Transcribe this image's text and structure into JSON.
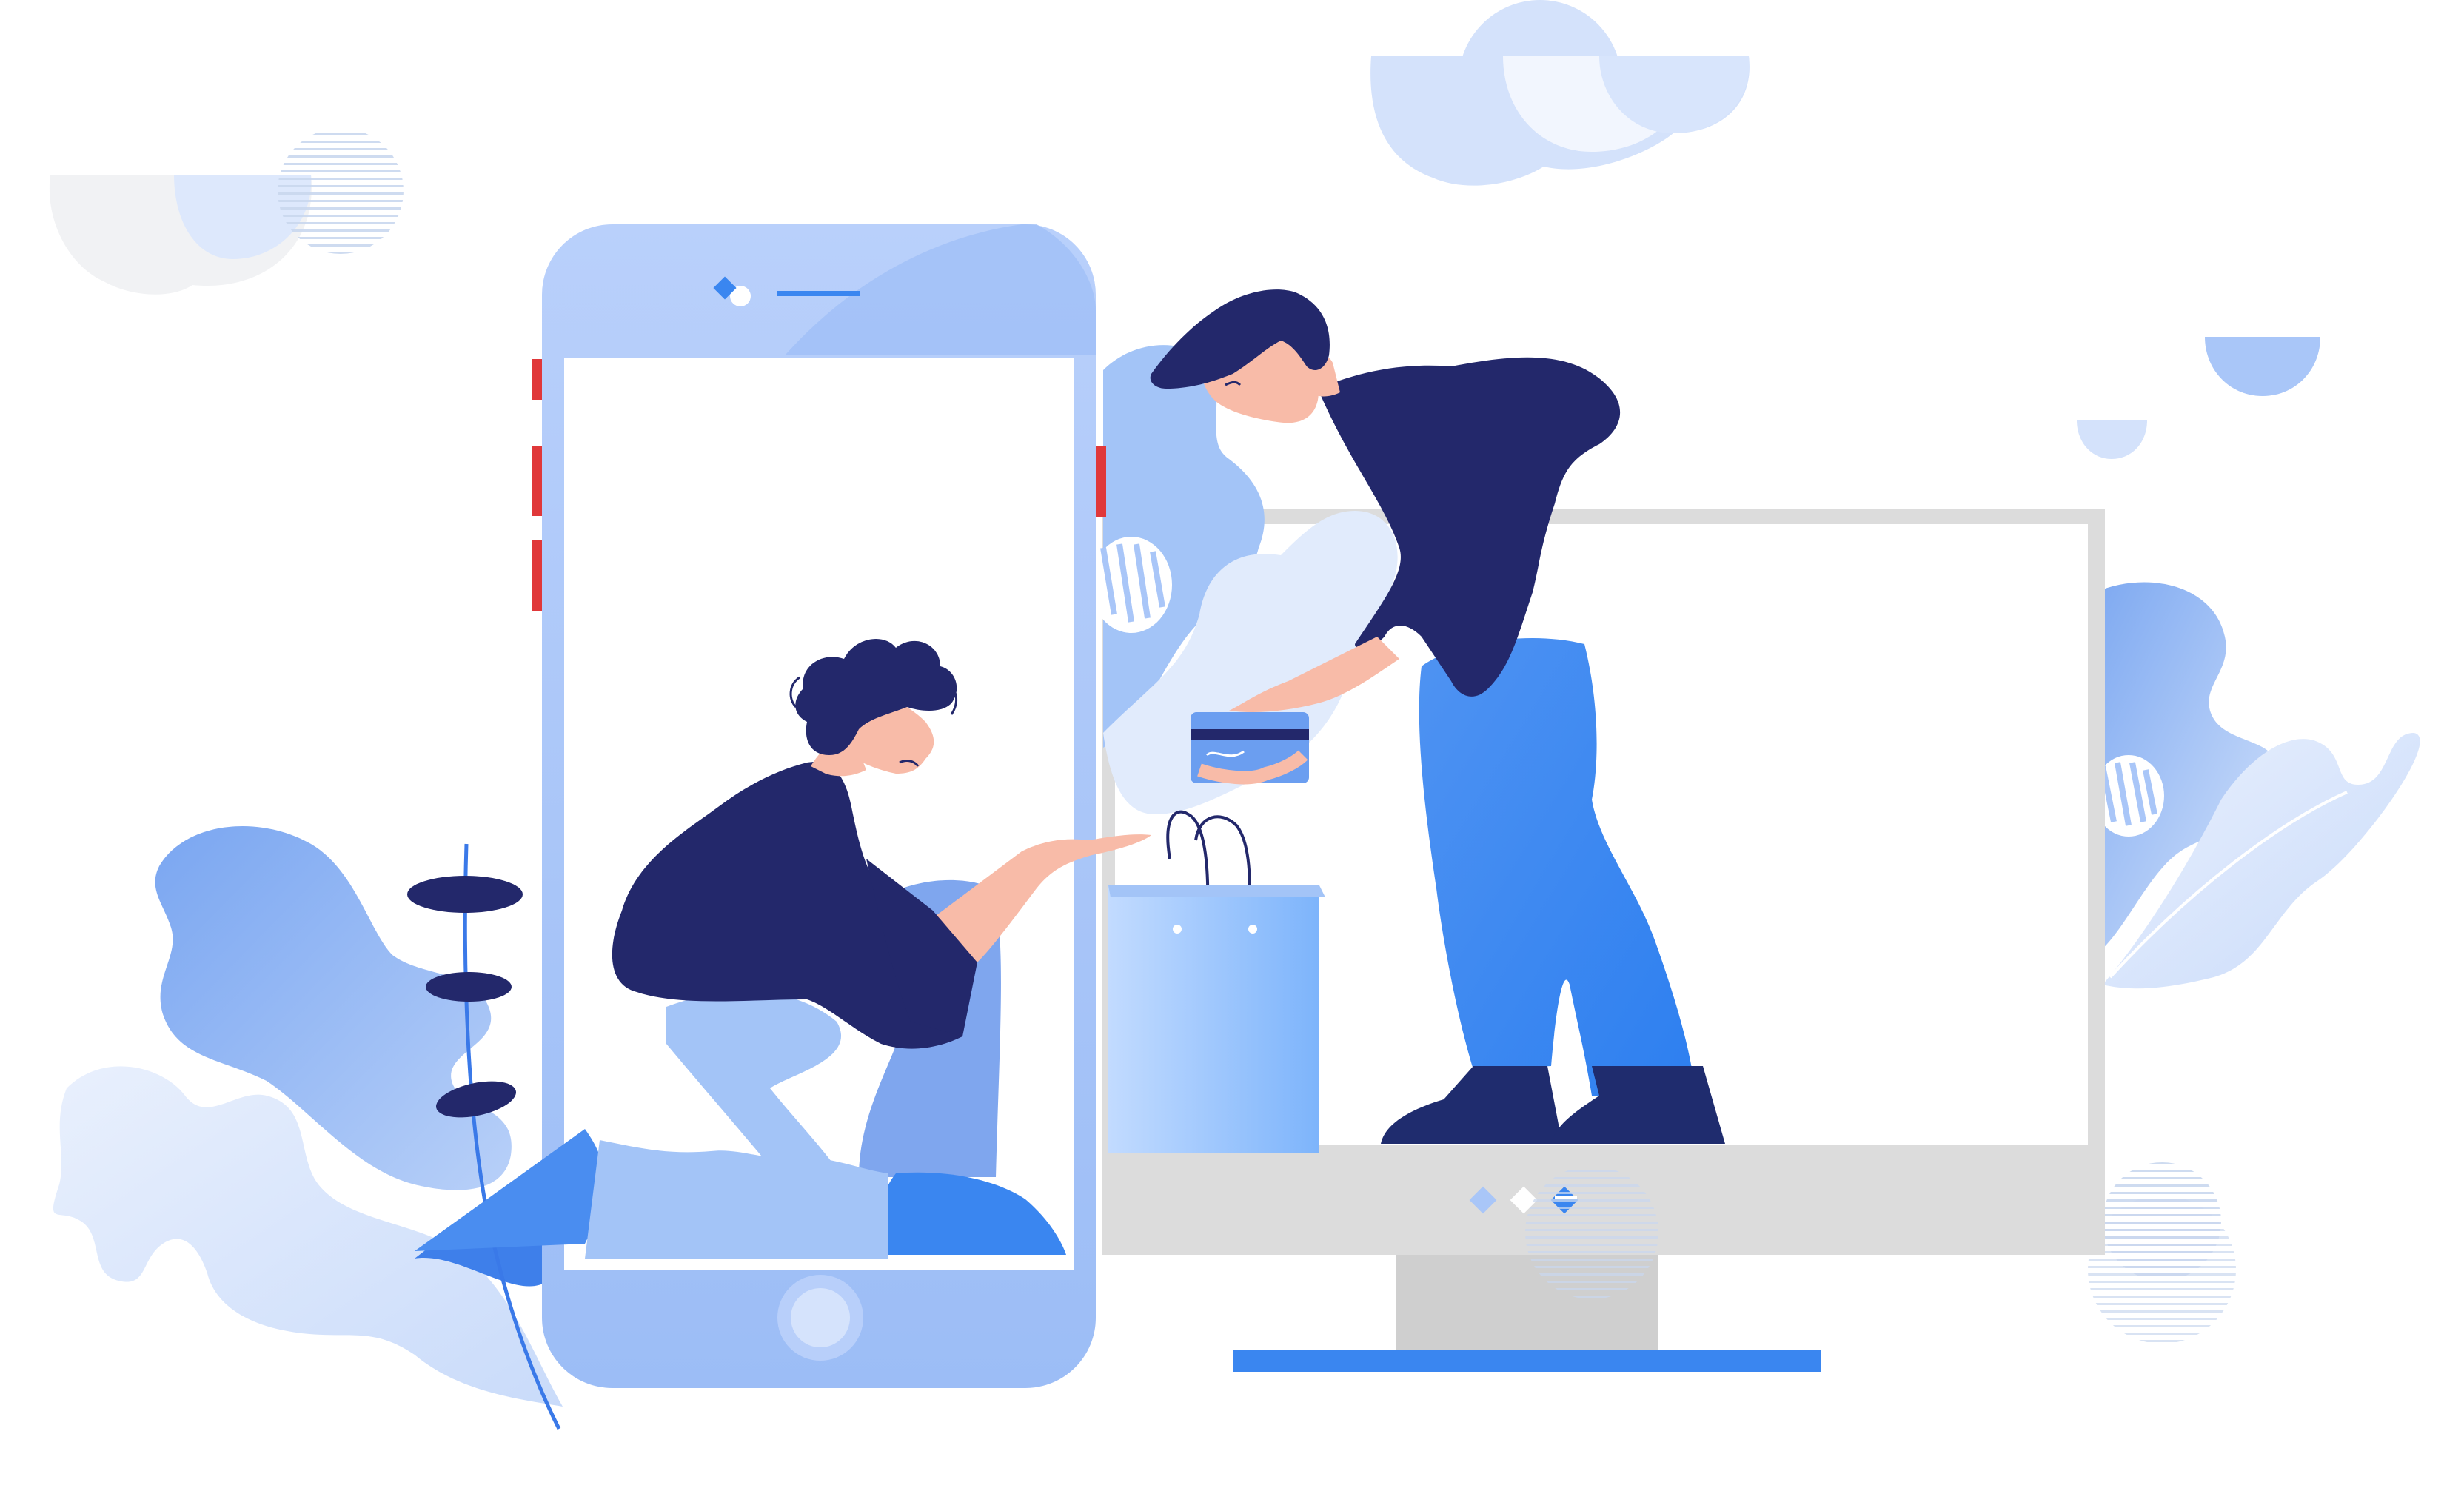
{
  "scene": {
    "subject": "person-handing-shopping-bag-from-desktop-to-phone",
    "colors": {
      "background": "#ffffff",
      "navy": "#23286b",
      "skin": "#f8bba8",
      "blue_primary": "#3d86f0",
      "blue_light": "#a3c4f7",
      "blue_pale": "#dbe7fb",
      "cloud_gray": "#f1f2f4",
      "monitor_gray": "#dcdcdc",
      "monitor_stand": "#cfcfcf",
      "accent_red": "#e0383a",
      "monitor_base_bar": "#3a86f0"
    },
    "icons": [
      "phone-device",
      "desktop-monitor",
      "shopping-bag",
      "credit-card",
      "leaf-decoration",
      "cloud-decoration"
    ]
  }
}
